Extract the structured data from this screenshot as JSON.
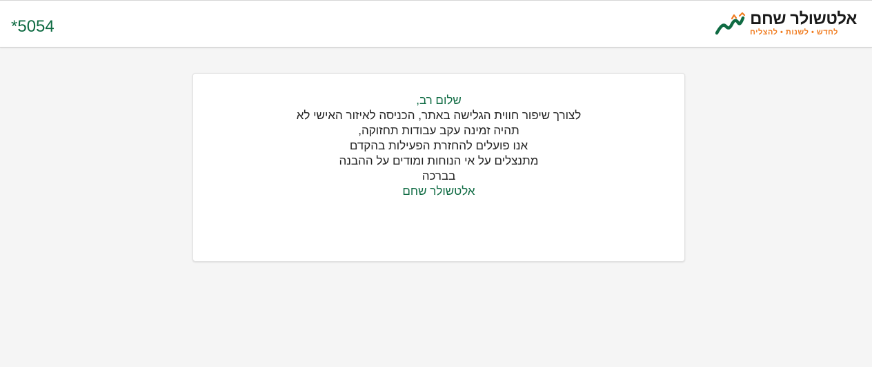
{
  "header": {
    "phone": "*5054",
    "logo": {
      "name": "אלטשולר שחם",
      "tagline": "לחדש • לשנות • להצליח",
      "mark_icon": "growth-arrow-logo-icon"
    }
  },
  "notice": {
    "greeting": "שלום רב,",
    "lines": [
      "לצורך שיפור חווית הגלישה באתר, הכניסה לאיזור האישי לא",
      "תהיה זמינה עקב עבודות תחזוקה,",
      "אנו פועלים להחזרת הפעילות בהקדם",
      "מתנצלים על אי הנוחות ומודים על ההבנה",
      "בברכה"
    ],
    "signature": "אלטשולר שחם"
  },
  "colors": {
    "brand_green": "#0f6b43",
    "brand_orange": "#f07b1e",
    "background": "#f5f5f5"
  }
}
